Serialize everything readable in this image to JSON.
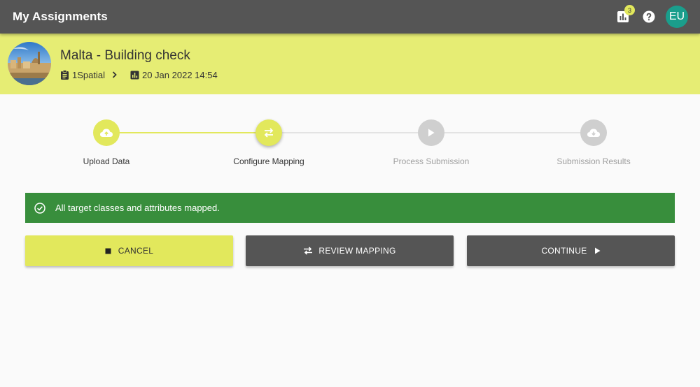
{
  "app": {
    "title": "My Assignments",
    "notification_count": "3",
    "user_initials": "EU"
  },
  "project": {
    "title": "Malta - Building check",
    "organization": "1Spatial",
    "datetime": "20 Jan 2022 14:54"
  },
  "stepper": {
    "steps": [
      {
        "label": "Upload Data",
        "state": "complete",
        "icon": "cloud-upload-icon"
      },
      {
        "label": "Configure Mapping",
        "state": "active",
        "icon": "swap-horiz-icon"
      },
      {
        "label": "Process Submission",
        "state": "pending",
        "icon": "play-icon"
      },
      {
        "label": "Submission Results",
        "state": "pending",
        "icon": "cloud-download-icon"
      }
    ]
  },
  "alert": {
    "message": "All target classes and attributes mapped.",
    "icon": "check-circle-outline-icon"
  },
  "actions": {
    "cancel_label": "CANCEL",
    "review_label": "REVIEW MAPPING",
    "continue_label": "CONTINUE"
  },
  "colors": {
    "topbar": "#555555",
    "accent": "#e2e85c",
    "header_bg": "#e6ed74",
    "success": "#388e3c",
    "avatar": "#1a9e8c",
    "pending": "#cfcfcf"
  }
}
